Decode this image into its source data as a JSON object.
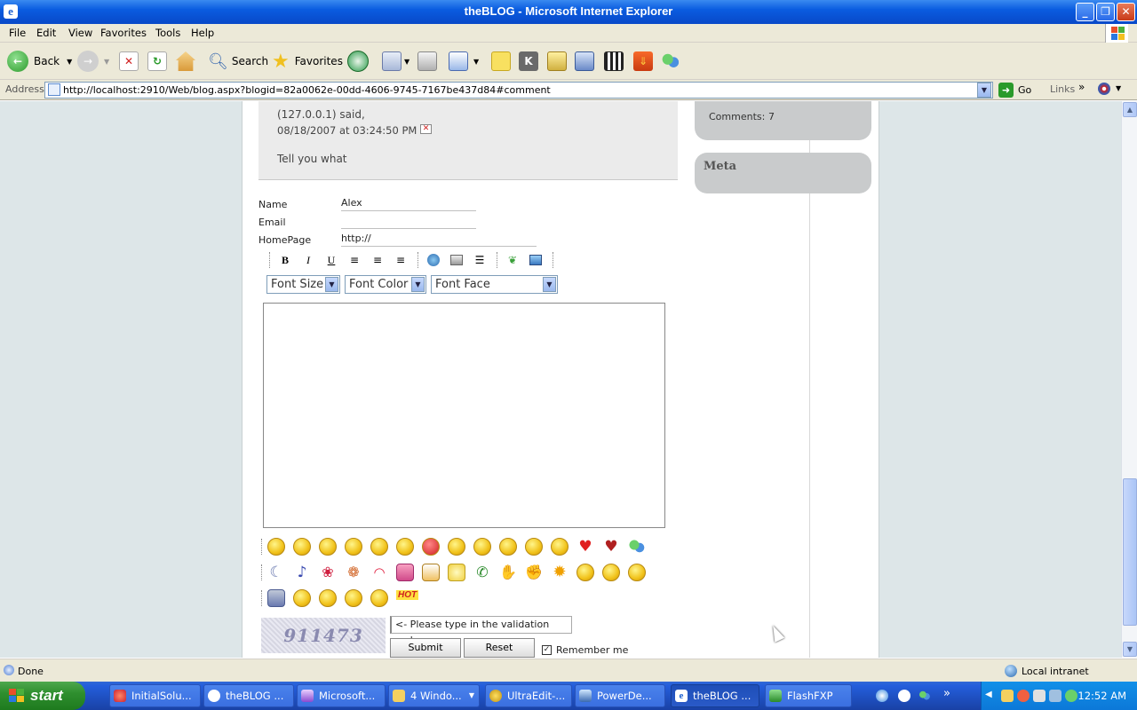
{
  "window": {
    "title": "theBLOG - Microsoft Internet Explorer"
  },
  "menu": [
    "File",
    "Edit",
    "View",
    "Favorites",
    "Tools",
    "Help"
  ],
  "toolbar": {
    "back": "Back",
    "search": "Search",
    "favorites": "Favorites"
  },
  "address": {
    "label": "Address",
    "url": "http://localhost:2910/Web/blog.aspx?blogid=82a0062e-00dd-4606-9745-7167be437d84#comment",
    "go": "Go",
    "links": "Links"
  },
  "post": {
    "author": "(127.0.0.1) said,",
    "date": "08/18/2007 at 03:24:50 PM",
    "text": "Tell you what"
  },
  "form": {
    "name_label": "Name",
    "name_value": "Alex",
    "email_label": "Email",
    "email_value": "",
    "homepage_label": "HomePage",
    "homepage_value": "http://"
  },
  "editor": {
    "bold": "B",
    "italic": "I",
    "underline": "U",
    "font_size": "Font Size",
    "font_color": "Font Color",
    "font_face": "Font Face"
  },
  "emoticons": {
    "hot_label": "HOT"
  },
  "validation": {
    "captcha": "911473",
    "hint": "<- Please type in the validation code.",
    "submit": "Submit",
    "reset": "Reset",
    "remember": "Remember me"
  },
  "sidebar": {
    "comments_label": "Comments:",
    "comments_value": "7",
    "meta_title": "Meta"
  },
  "status": {
    "left": "Done",
    "zone": "Local intranet"
  },
  "taskbar": {
    "start": "start",
    "tasks": [
      "InitialSolu...",
      "theBLOG ...",
      "Microsoft...",
      "4 Windo...",
      "UltraEdit-...",
      "PowerDe...",
      "theBLOG ...",
      "FlashFXP"
    ],
    "clock": "12:52 AM"
  },
  "colors": {
    "titlebar": "#0a5ce0",
    "page_bg": "#dde6e8",
    "sidebar_box": "#c9cbcc",
    "taskbar": "#245edb",
    "start": "#2f8f2f"
  }
}
